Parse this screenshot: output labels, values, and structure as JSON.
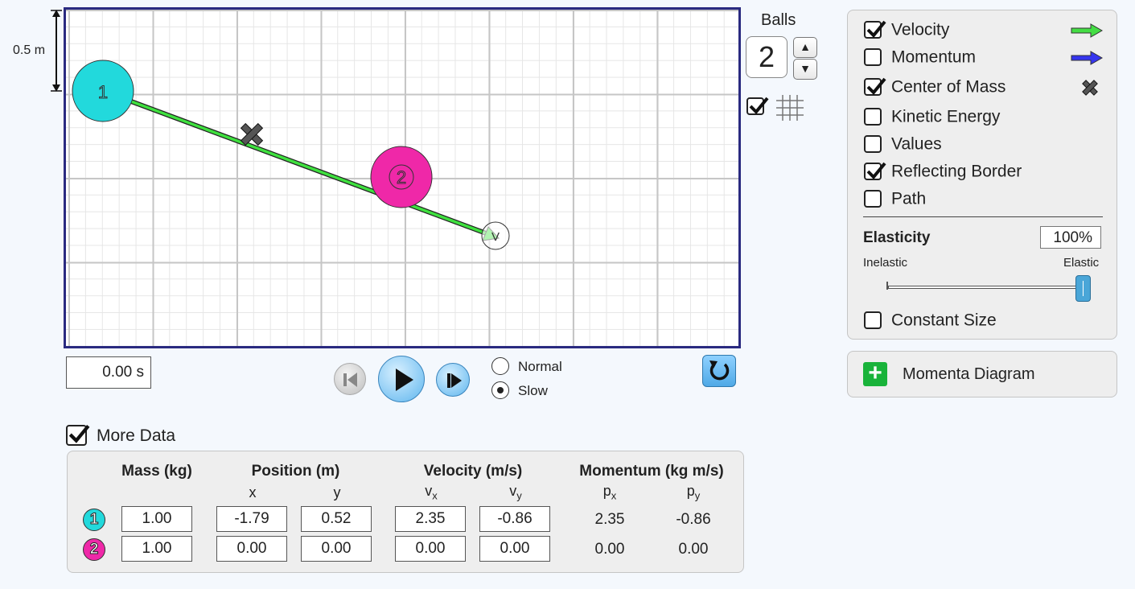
{
  "scale": {
    "label": "0.5 m"
  },
  "play_area": {
    "time": "0.00 s",
    "balls": [
      {
        "label": "1",
        "color": "#22d9dc",
        "x": -1.79,
        "y": 0.52
      },
      {
        "label": "2",
        "color": "#ef28a8",
        "x": 0.0,
        "y": 0.0
      }
    ],
    "velocity_tip_label": "V",
    "center_of_mass_icon": "x-mark-icon"
  },
  "balls_control": {
    "label": "Balls",
    "value": "2",
    "up_icon": "triangle-up-icon",
    "down_icon": "triangle-down-icon"
  },
  "grid_toggle": {
    "checked": true,
    "icon": "grid-icon"
  },
  "options": {
    "items": [
      {
        "label": "Velocity",
        "checked": true,
        "icon": "green-arrow-icon",
        "icon_color": "#33dd33"
      },
      {
        "label": "Momentum",
        "checked": false,
        "icon": "blue-arrow-icon",
        "icon_color": "#3333ee"
      },
      {
        "label": "Center of Mass",
        "checked": true,
        "icon": "x-mark-icon"
      },
      {
        "label": "Kinetic Energy",
        "checked": false
      },
      {
        "label": "Values",
        "checked": false
      },
      {
        "label": "Reflecting Border",
        "checked": true
      },
      {
        "label": "Path",
        "checked": false
      }
    ],
    "elasticity": {
      "title": "Elasticity",
      "value": "100%",
      "min_label": "Inelastic",
      "max_label": "Elastic",
      "level": 1.0
    },
    "constant_size": {
      "label": "Constant Size",
      "checked": false
    }
  },
  "momenta_diagram": {
    "label": "Momenta Diagram",
    "icon": "plus-icon",
    "accent": "#19b33a"
  },
  "playback": {
    "speed_options": [
      "Normal",
      "Slow"
    ],
    "selected_speed": "Slow"
  },
  "more_data": {
    "label": "More Data",
    "checked": true,
    "headers": {
      "mass": "Mass (kg)",
      "position": "Position (m)",
      "velocity": "Velocity (m/s)",
      "momentum": "Momentum (kg m/s)"
    },
    "subheaders": {
      "x": "x",
      "y": "y",
      "vx": "v",
      "vx_sub": "x",
      "vy": "v",
      "vy_sub": "y",
      "px": "p",
      "px_sub": "x",
      "py": "p",
      "py_sub": "y"
    },
    "rows": [
      {
        "ball": "1",
        "color": "#22d9dc",
        "mass": "1.00",
        "x": "-1.79",
        "y": "0.52",
        "vx": "2.35",
        "vy": "-0.86",
        "px": "2.35",
        "py": "-0.86"
      },
      {
        "ball": "2",
        "color": "#ef28a8",
        "mass": "1.00",
        "x": "0.00",
        "y": "0.00",
        "vx": "0.00",
        "vy": "0.00",
        "px": "0.00",
        "py": "0.00"
      }
    ]
  }
}
